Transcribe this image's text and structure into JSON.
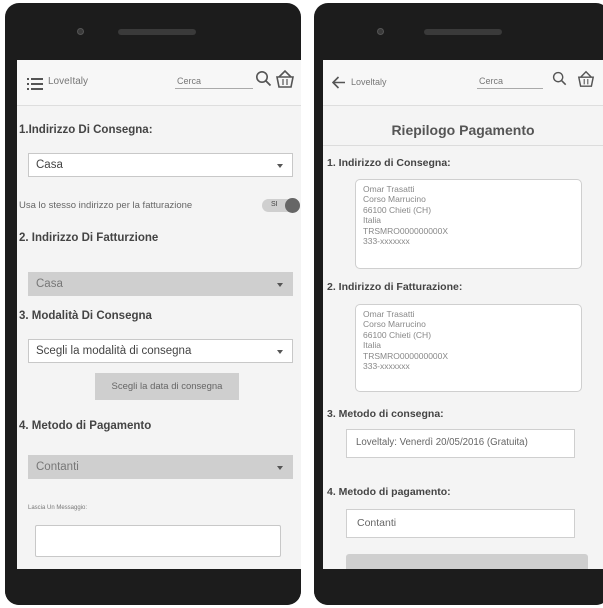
{
  "left": {
    "header": {
      "brand": "LoveItaly",
      "search_placeholder": "Cerca"
    },
    "shipping_address": {
      "title": "1.Indirizzo Di Consegna:",
      "selected": "Casa"
    },
    "same_address": {
      "label": "Usa lo stesso indirizzo per la fatturazione",
      "toggle_label": "SI",
      "on": true
    },
    "billing_address": {
      "title": "2. Indirizzo Di Fatturzione",
      "selected": "Casa"
    },
    "delivery_mode": {
      "title": "3. Modalità Di Consegna",
      "selected": "Scegli la modalità di consegna",
      "date_button": "Scegli la data di consegna"
    },
    "payment": {
      "title": "4. Metodo di Pagamento",
      "selected": "Contanti"
    },
    "message": {
      "label": "Lascia Un Messaggio:"
    }
  },
  "right": {
    "header": {
      "brand": "Loveltaly",
      "search_placeholder": "Cerca"
    },
    "title": "Riepilogo Pagamento",
    "shipping": {
      "title": "1. Indirizzo di Consegna:",
      "lines": [
        "Omar Trasatti",
        "Corso Marrucino",
        "66100 Chieti (CH)",
        "Italia",
        "TRSMRO000000000X",
        "333-xxxxxxx"
      ]
    },
    "billing": {
      "title": "2. Indirizzo di Fatturazione:",
      "lines": [
        "Omar Trasatti",
        "Corso Marrucino",
        "66100 Chieti (CH)",
        "Italia",
        "TRSMRO000000000X",
        "333-xxxxxxx"
      ]
    },
    "delivery": {
      "title": "3. Metodo di consegna:",
      "value": "Loveltaly: Venerdì 20/05/2016 (Gratuita)"
    },
    "payment": {
      "title": "4. Metodo di pagamento:",
      "value": "Contanti"
    }
  },
  "icons": {
    "menu": "menu-icon",
    "search": "search-icon",
    "basket": "basket-icon",
    "back": "back-arrow-icon"
  },
  "colors": {
    "screen_bg": "#f4f4f4",
    "frame": "#1c1c1c",
    "control_grey": "#cfcfcf"
  }
}
